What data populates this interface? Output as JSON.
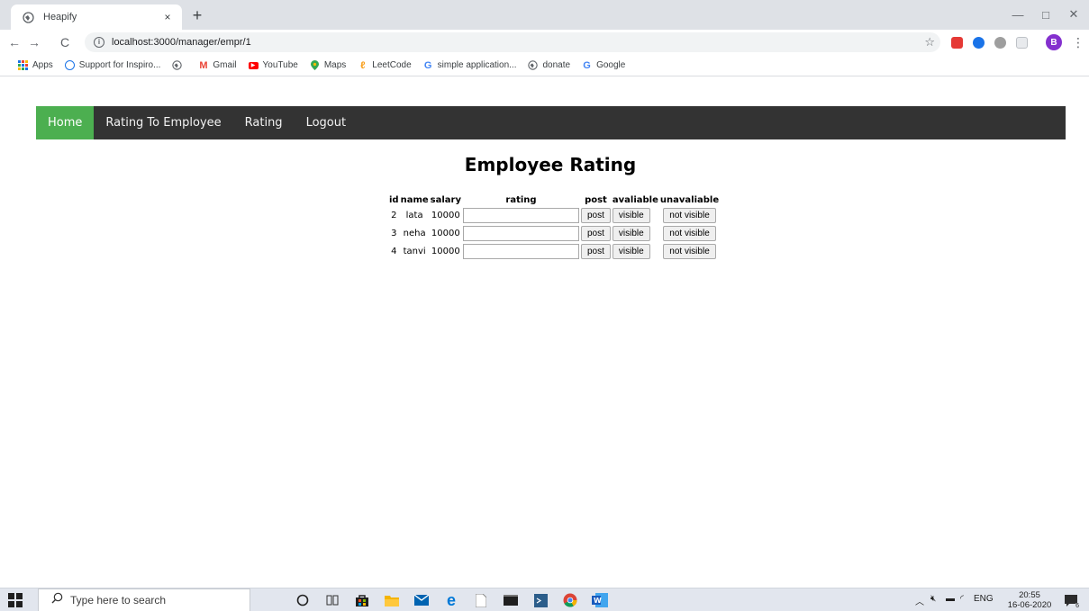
{
  "browser": {
    "tab_title": "Heapify",
    "tab_close": "×",
    "new_tab": "+",
    "url": "localhost:3000/manager/empr/1",
    "window_minimize": "—",
    "window_maximize": "□",
    "window_close": "✕",
    "avatar_letter": "B",
    "bookmarks": [
      {
        "label": "Apps",
        "icon": "apps-grid-icon"
      },
      {
        "label": "Support for Inspiro...",
        "icon": "inspiro-icon"
      },
      {
        "label": "",
        "icon": "globe-icon"
      },
      {
        "label": "Gmail",
        "icon": "gmail-icon"
      },
      {
        "label": "YouTube",
        "icon": "youtube-icon"
      },
      {
        "label": "Maps",
        "icon": "maps-pin-icon"
      },
      {
        "label": "LeetCode",
        "icon": "leetcode-icon"
      },
      {
        "label": "simple application...",
        "icon": "google-g-icon"
      },
      {
        "label": "donate",
        "icon": "globe-icon"
      },
      {
        "label": "Google",
        "icon": "google-g-icon"
      }
    ]
  },
  "nav": {
    "items": [
      {
        "label": "Home",
        "active": true
      },
      {
        "label": "Rating To Employee",
        "active": false
      },
      {
        "label": "Rating",
        "active": false
      },
      {
        "label": "Logout",
        "active": false
      }
    ],
    "bg_color": "#333333",
    "active_color": "#4caf50"
  },
  "page": {
    "title": "Employee Rating"
  },
  "table": {
    "headers": {
      "id": "id",
      "name": "name",
      "salary": "salary",
      "rating": "rating",
      "post": "post",
      "available": "avaliable",
      "unavailable": "unavaliable"
    },
    "rows": [
      {
        "id": "2",
        "name": "lata",
        "salary": "10000",
        "rating": "",
        "post_label": "post",
        "visible_label": "visible",
        "not_visible_label": "not visible"
      },
      {
        "id": "3",
        "name": "neha",
        "salary": "10000",
        "rating": "",
        "post_label": "post",
        "visible_label": "visible",
        "not_visible_label": "not visible"
      },
      {
        "id": "4",
        "name": "tanvi",
        "salary": "10000",
        "rating": "",
        "post_label": "post",
        "visible_label": "visible",
        "not_visible_label": "not visible"
      }
    ]
  },
  "taskbar": {
    "search_placeholder": "Type here to search",
    "language": "ENG",
    "time": "20:55",
    "date": "16-06-2020",
    "notification_count": "6"
  }
}
